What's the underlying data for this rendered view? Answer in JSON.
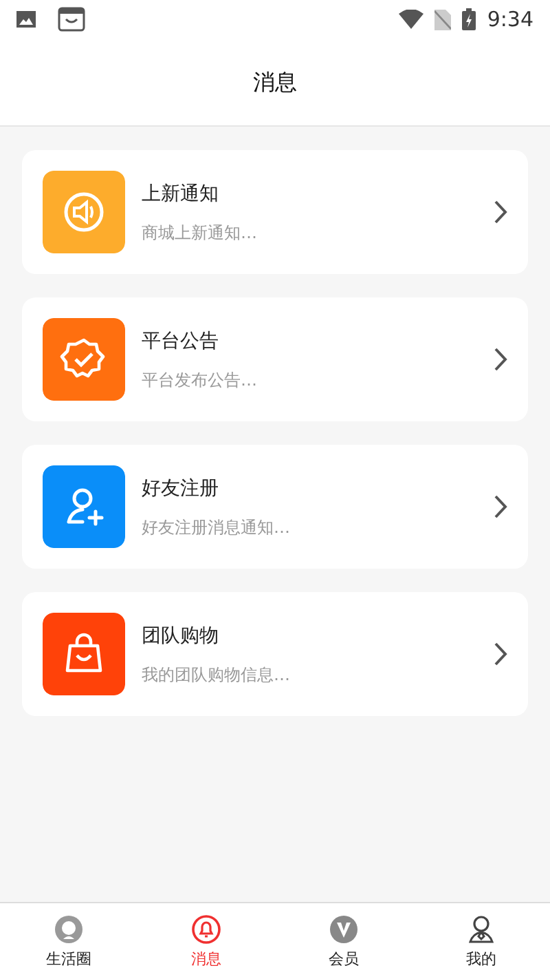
{
  "status_bar": {
    "time": "9:34"
  },
  "header": {
    "title": "消息"
  },
  "messages": [
    {
      "kind": "speaker",
      "color": "#fdac2c",
      "title": "上新通知",
      "subtitle": "商城上新通知…"
    },
    {
      "kind": "badge",
      "color": "#ff6f0f",
      "title": "平台公告",
      "subtitle": "平台发布公告…"
    },
    {
      "kind": "user-add",
      "color": "#0a8ef9",
      "title": "好友注册",
      "subtitle": "好友注册消息通知…"
    },
    {
      "kind": "bag",
      "color": "#ff4209",
      "title": "团队购物",
      "subtitle": "我的团队购物信息…"
    }
  ],
  "tab_bar": [
    {
      "kind": "mascot",
      "label": "生活圈",
      "selected": false
    },
    {
      "kind": "bell",
      "label": "消息",
      "selected": true
    },
    {
      "kind": "vip",
      "label": "会员",
      "selected": false
    },
    {
      "kind": "person",
      "label": "我的",
      "selected": false
    }
  ]
}
